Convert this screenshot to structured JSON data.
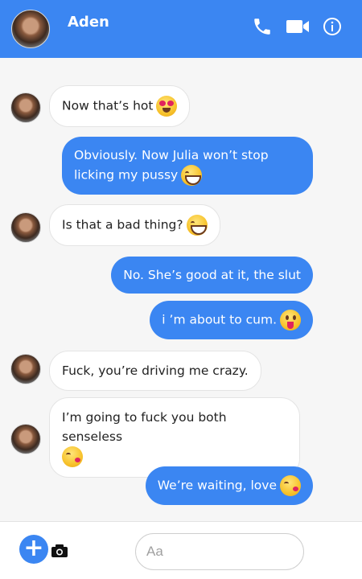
{
  "header": {
    "contact_name": "Aden",
    "icons": [
      "phone-icon",
      "video-camera-icon",
      "info-icon"
    ]
  },
  "messages": [
    {
      "direction": "incoming",
      "text": "Now that’s hot",
      "emoji": "heart-eyes"
    },
    {
      "direction": "outgoing",
      "text": "Obviously. Now Julia won’t stop licking my pussy",
      "emoji": "grin-sweat"
    },
    {
      "direction": "incoming",
      "text": "Is that a bad thing?",
      "emoji": "grin-sweat"
    },
    {
      "direction": "outgoing",
      "text": "No. She’s good at it, the slut",
      "emoji": ""
    },
    {
      "direction": "outgoing",
      "text": "i ’m about to cum.",
      "emoji": "tongue-out"
    },
    {
      "direction": "incoming",
      "text": "Fuck, you’re driving me crazy.",
      "emoji": ""
    },
    {
      "direction": "incoming",
      "text": "I’m going to fuck you both senseless",
      "emoji": "kiss-heart"
    },
    {
      "direction": "outgoing",
      "text": "We’re waiting, love",
      "emoji": "kiss-heart"
    }
  ],
  "composer": {
    "add_label": "+",
    "placeholder": "Aa",
    "icons": [
      "plus-icon",
      "camera-icon"
    ]
  },
  "colors": {
    "accent": "#3b86f2",
    "background": "#f6f6f6"
  }
}
